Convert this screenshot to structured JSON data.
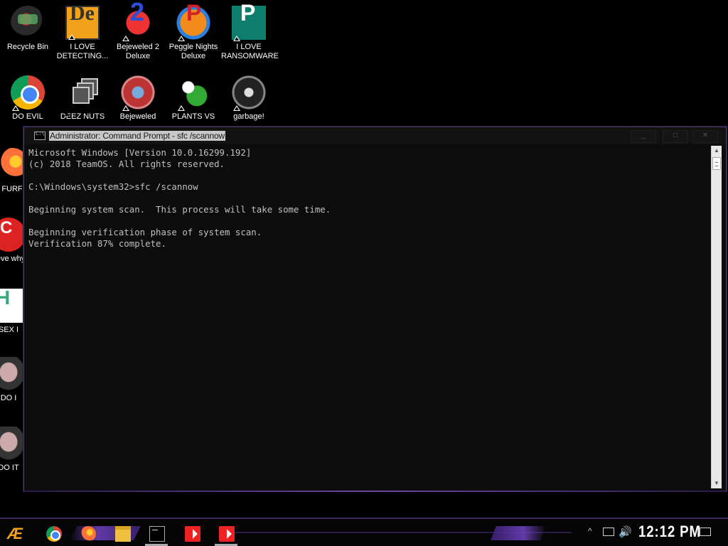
{
  "desktop_icons": [
    {
      "label": "Recycle Bin",
      "icon": "recycle-bin-icon"
    },
    {
      "label": "I LOVE DETECTING...",
      "icon": "detective-icon"
    },
    {
      "label": "Bejeweled 2 Deluxe",
      "icon": "bejeweled2-icon"
    },
    {
      "label": "Peggle Nights Deluxe",
      "icon": "peggle-icon"
    },
    {
      "label": "I LOVE RANSOMWARE",
      "icon": "publisher-icon"
    },
    {
      "label": "DO EVIL",
      "icon": "chrome-icon"
    },
    {
      "label": "DEEZ NUTS",
      "icon": "stacked-windows-icon"
    },
    {
      "label": "Bejeweled",
      "icon": "bejeweled-twist-icon"
    },
    {
      "label": "PLANTS VS",
      "icon": "pvz-icon"
    },
    {
      "label": "garbage!",
      "icon": "skull-icon"
    },
    {
      "label": "FURF",
      "icon": "firefox-icon"
    },
    {
      "label": "neve why",
      "icon": "dc-icon"
    },
    {
      "label": "SEX I",
      "icon": "hx-icon"
    },
    {
      "label": "DO I",
      "icon": "face-icon"
    },
    {
      "label": "DO IT",
      "icon": "face-icon"
    }
  ],
  "cmd_window": {
    "title": "Administrator: Command Prompt - sfc  /scannow",
    "minimize": "_",
    "maximize": "□",
    "close": "✕",
    "console_lines": [
      "Microsoft Windows [Version 10.0.16299.192]",
      "(c) 2018 TeamOS. All rights reserved.",
      "",
      "C:\\Windows\\system32>sfc /scannow",
      "",
      "Beginning system scan.  This process will take some time.",
      "",
      "Beginning verification phase of system scan.",
      "Verification 87% complete."
    ]
  },
  "taskbar": {
    "start_glyph": "Æ",
    "apps": [
      {
        "name": "chrome",
        "icon": "chrome-icon",
        "active": false
      },
      {
        "name": "firefox",
        "icon": "firefox-icon",
        "active": false
      },
      {
        "name": "file-explorer",
        "icon": "folder-icon",
        "active": false
      },
      {
        "name": "command-prompt",
        "icon": "cmd-icon",
        "active": true
      },
      {
        "name": "anydesk-1",
        "icon": "anydesk-icon",
        "active": false
      },
      {
        "name": "anydesk-2",
        "icon": "anydesk-icon",
        "active": true
      }
    ],
    "tray_chevron": "^",
    "volume_glyph": "🔊",
    "clock": "12:12 PM"
  },
  "colors": {
    "console_bg": "#0c0c0c",
    "console_text": "#c0c0c0",
    "accent_purple": "#6a40b8"
  }
}
